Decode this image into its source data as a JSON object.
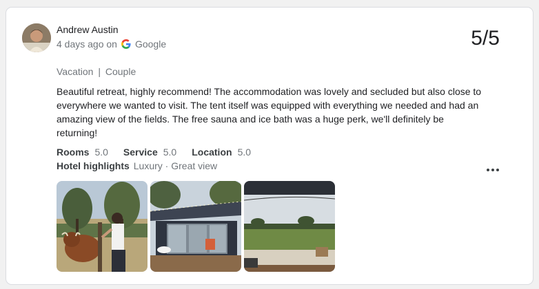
{
  "review": {
    "author": "Andrew Austin",
    "time_ago": "4 days ago on",
    "source": "Google",
    "score": "5/5",
    "trip_type": "Vacation",
    "trip_sep": "|",
    "trip_group": "Couple",
    "text": "Beautiful retreat, highly recommend! The accommodation was lovely and secluded but also close to everywhere we wanted to visit. The tent itself was equipped with everything we needed and had an amazing view of the fields. The free sauna and ice bath was a huge perk, we'll definitely be returning!",
    "ratings": [
      {
        "label": "Rooms",
        "value": "5.0"
      },
      {
        "label": "Service",
        "value": "5.0"
      },
      {
        "label": "Location",
        "value": "5.0"
      }
    ],
    "highlights_label": "Hotel highlights",
    "highlights_value": "Luxury · Great view"
  },
  "colors": {
    "text_primary": "#202124",
    "text_secondary": "#70757a",
    "border": "#dadce0"
  },
  "icons": {
    "source_logo": "google-g-icon",
    "menu": "more-vertical-icon"
  }
}
